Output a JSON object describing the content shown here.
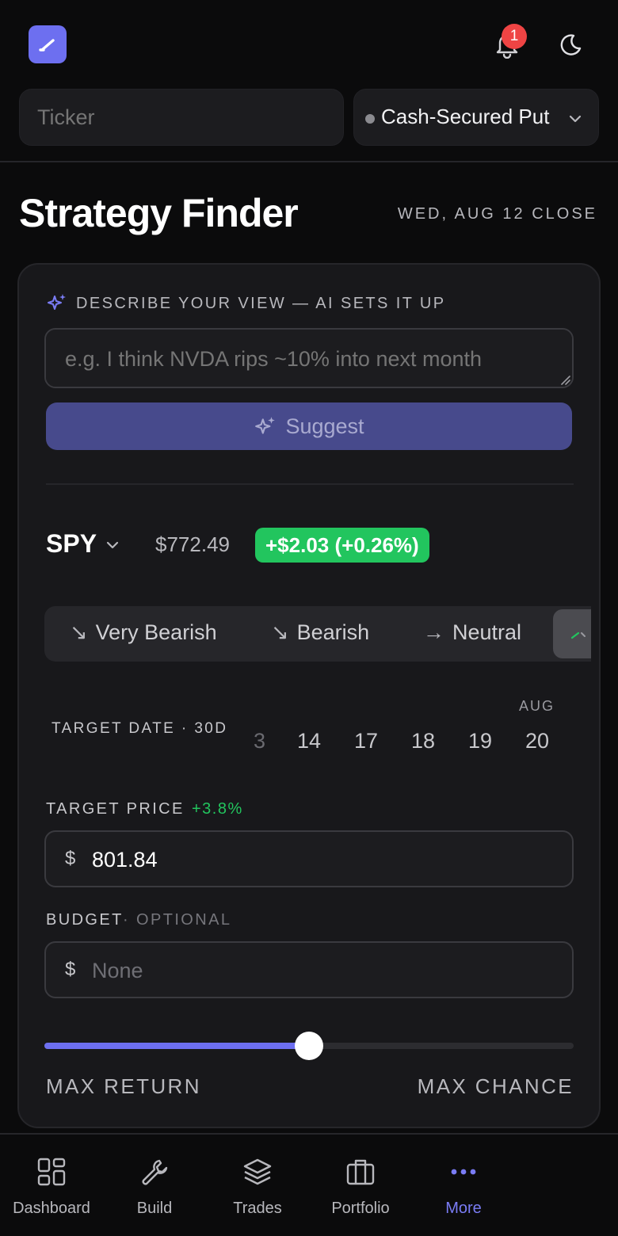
{
  "header": {
    "notification_count": "1",
    "ticker_placeholder": "Ticker",
    "strategy_label": "Cash-Secured Put"
  },
  "page": {
    "title": "Strategy Finder",
    "close_date": "WED, AUG 12 CLOSE"
  },
  "ai": {
    "label": "DESCRIBE YOUR VIEW — AI SETS IT UP",
    "placeholder": "e.g. I think NVDA rips ~10% into next month",
    "suggest_label": "Suggest"
  },
  "quote": {
    "symbol": "SPY",
    "price": "$772.49",
    "change": "+$2.03 (+0.26%)",
    "change_color": "#22c55e"
  },
  "sentiment": {
    "options": [
      {
        "icon": "↘",
        "label": "Very Bearish"
      },
      {
        "icon": "↘",
        "label": "Bearish"
      },
      {
        "icon": "→",
        "label": "Neutral"
      }
    ]
  },
  "target_date": {
    "label": "TARGET DATE · 30D",
    "month": "AUG",
    "days": [
      "3",
      "14",
      "17",
      "18",
      "19",
      "20"
    ]
  },
  "target_price": {
    "label": "TARGET PRICE",
    "pct": "+3.8%",
    "currency": "$",
    "value": "801.84"
  },
  "budget": {
    "label": "BUDGET",
    "optional": "· OPTIONAL",
    "currency": "$",
    "placeholder": "None"
  },
  "tradeoff": {
    "position": 0.5,
    "left_label": "MAX RETURN",
    "right_label": "MAX CHANCE"
  },
  "nav": [
    {
      "label": "Dashboard",
      "icon": "grid-icon"
    },
    {
      "label": "Build",
      "icon": "wrench-icon"
    },
    {
      "label": "Trades",
      "icon": "layers-icon"
    },
    {
      "label": "Portfolio",
      "icon": "briefcase-icon"
    },
    {
      "label": "More",
      "icon": "more-dots-icon",
      "active": true
    }
  ],
  "colors": {
    "accent": "#6d6ff0",
    "positive": "#22c55e",
    "badge": "#ef4444",
    "background": "#0b0b0c"
  }
}
